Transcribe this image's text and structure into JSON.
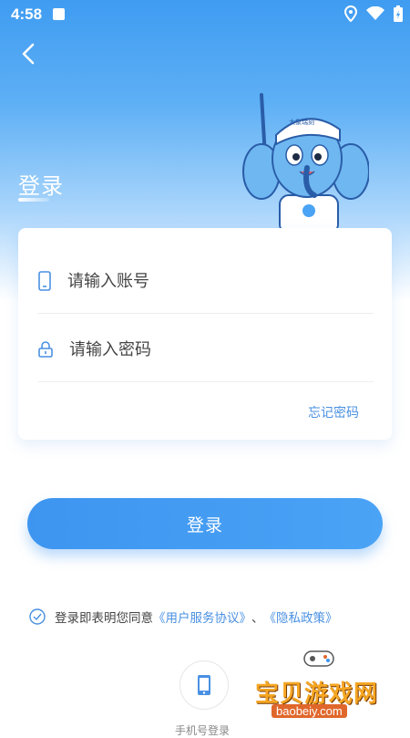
{
  "status_bar": {
    "time": "4:58",
    "icons": [
      "a-app-icon",
      "location-icon",
      "wifi-icon",
      "battery-icon"
    ]
  },
  "header": {
    "back_icon": "chevron-left-icon",
    "title": "登录"
  },
  "mascot": {
    "cap_text": "大象瑞刻"
  },
  "form": {
    "account": {
      "placeholder": "请输入账号",
      "value": "",
      "icon": "phone-icon"
    },
    "password": {
      "placeholder": "请输入密码",
      "value": "",
      "icon": "lock-icon"
    },
    "forgot_label": "忘记密码"
  },
  "login_button": {
    "label": "登录"
  },
  "agreement": {
    "prefix": "登录即表明您同意",
    "user_agreement": "《用户服务协议》",
    "separator": "、",
    "privacy_policy": "《隐私政策》"
  },
  "alt_login": {
    "phone_label": "手机号登录",
    "icon": "phone-icon"
  },
  "watermark": {
    "text": "宝贝游戏网",
    "url": "baobeiy.com"
  },
  "colors": {
    "primary": "#4a90e2",
    "button": "#3e95f0",
    "header_gradient_top": "#3f9cf1"
  }
}
